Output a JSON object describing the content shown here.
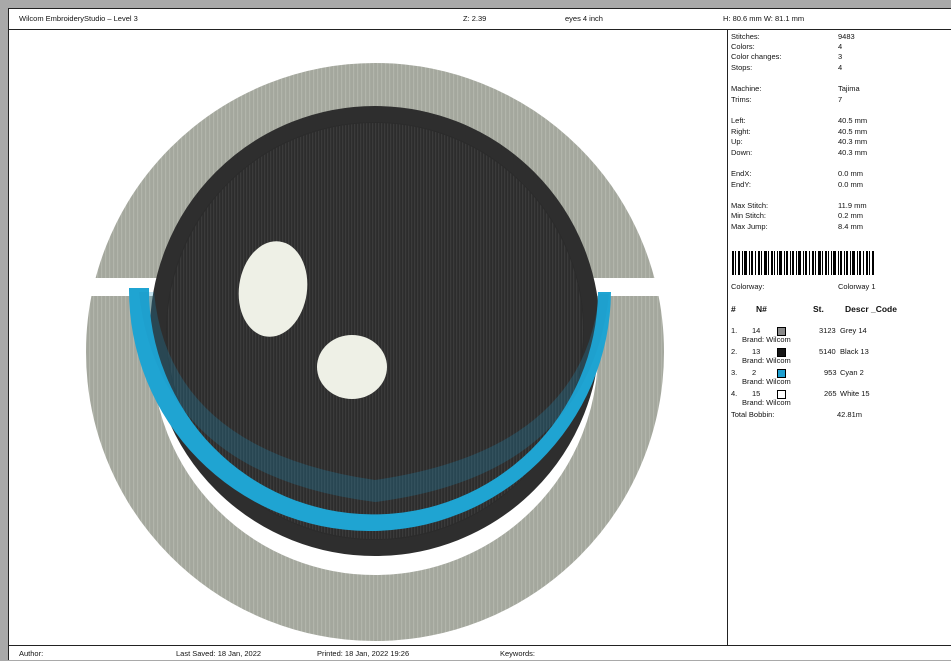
{
  "header": {
    "title": "Wilcom EmbroideryStudio – Level 3",
    "zoom": "Z: 2.39",
    "design_name": "eyes 4 inch",
    "dimensions": "H: 80.6 mm   W: 81.1 mm"
  },
  "stats": [
    {
      "label": "Stitches:",
      "value": "9483"
    },
    {
      "label": "Colors:",
      "value": "4"
    },
    {
      "label": "Color changes:",
      "value": "3"
    },
    {
      "label": "Stops:",
      "value": "4"
    },
    {
      "label": "Machine:",
      "value": "Tajima"
    },
    {
      "label": "Trims:",
      "value": "7"
    },
    {
      "label": "Left:",
      "value": "40.5 mm"
    },
    {
      "label": "Right:",
      "value": "40.5 mm"
    },
    {
      "label": "Up:",
      "value": "40.3 mm"
    },
    {
      "label": "Down:",
      "value": "40.3 mm"
    },
    {
      "label": "EndX:",
      "value": "0.0 mm"
    },
    {
      "label": "EndY:",
      "value": "0.0 mm"
    },
    {
      "label": "Max Stitch:",
      "value": "11.9 mm"
    },
    {
      "label": "Min Stitch:",
      "value": "0.2 mm"
    },
    {
      "label": "Max Jump:",
      "value": "8.4 mm"
    }
  ],
  "colorway": {
    "label": "Colorway:",
    "value": "Colorway 1"
  },
  "table": {
    "headers": {
      "idx": "#",
      "num": "N#",
      "st": "St.",
      "descr": "Descr _Code"
    },
    "rows": [
      {
        "idx": "1.",
        "num": "14",
        "color": "#8a8a8a",
        "st": "3123",
        "descr": "Grey 14",
        "brand": "Brand: Wilcom"
      },
      {
        "idx": "2.",
        "num": "13",
        "color": "#151515",
        "st": "5140",
        "descr": "Black 13",
        "brand": "Brand: Wilcom"
      },
      {
        "idx": "3.",
        "num": "2",
        "color": "#1e9fd0",
        "st": "953",
        "descr": "Cyan 2",
        "brand": "Brand: Wilcom"
      },
      {
        "idx": "4.",
        "num": "15",
        "color": "#ffffff",
        "st": "265",
        "descr": "White 15",
        "brand": "Brand: Wilcom"
      }
    ]
  },
  "bobbin": {
    "label": "Total Bobbin:",
    "value": "42.81m"
  },
  "footer": {
    "author": "Author:",
    "saved": "Last Saved:  18 Jan, 2022",
    "printed": "Printed:  18 Jan, 2022 19:26",
    "keywords": "Keywords:"
  },
  "colors": {
    "grey_thread": "#a3a69c",
    "black_thread": "#2b2b2b",
    "cyan_thread": "#1fa4d2",
    "white_thread": "#eef0e6"
  }
}
